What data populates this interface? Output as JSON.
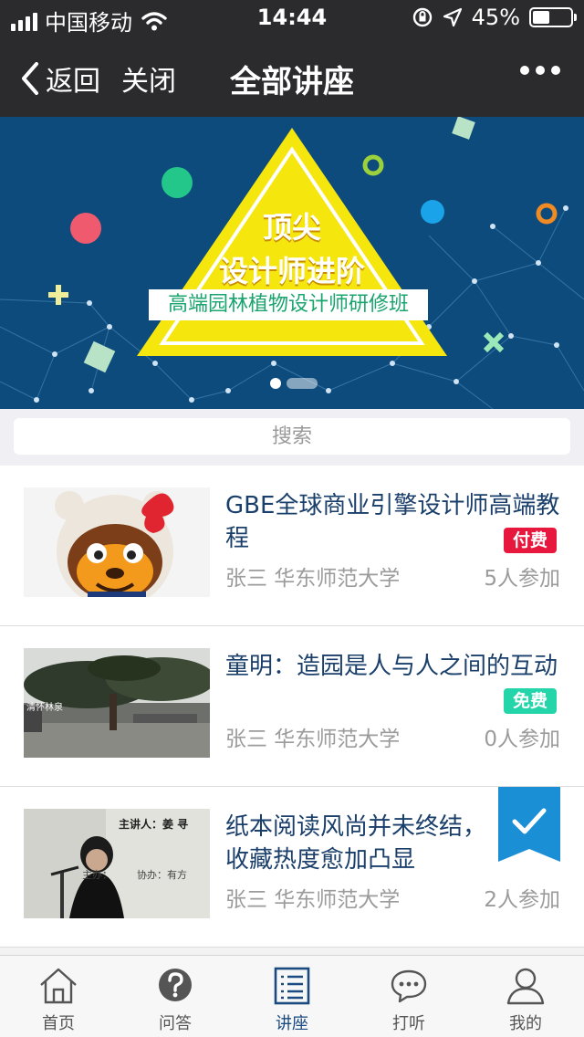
{
  "status_bar": {
    "carrier": "中国移动",
    "time": "14:44",
    "battery_percent_text": "45%",
    "battery_level": 0.45,
    "icons": [
      "signal-icon",
      "wifi-icon",
      "rotation-lock-icon",
      "location-icon",
      "battery-icon"
    ]
  },
  "nav": {
    "back_label": "返回",
    "close_label": "关闭",
    "title": "全部讲座",
    "more_icon": "more-dots-icon"
  },
  "banner": {
    "headline_line1": "顶尖",
    "headline_line2": "设计师进阶",
    "subtitle": "高端园林植物设计师研修班",
    "colors": {
      "background": "#0d4b7c",
      "triangle": "#f5e60e"
    },
    "slides_total": 2,
    "active_slide": 1
  },
  "search": {
    "placeholder": "搜索"
  },
  "lectures": [
    {
      "title": "GBE全球商业引擎设计师高端教程",
      "price_label": "付费",
      "price_type": "paid",
      "speaker": "张三 华东师范大学",
      "participants": "5人参加",
      "thumb": "monkey-mascot-photo",
      "bookmarked": false
    },
    {
      "title": "童明：造园是人与人之间的互动",
      "price_label": "免费",
      "price_type": "free",
      "speaker": "张三 华东师范大学",
      "participants": "0人参加",
      "thumb": "garden-tree-photo",
      "thumb_caption": "清怀林泉",
      "bookmarked": false
    },
    {
      "title": "纸本阅读风尚并未终结，收藏热度愈加凸显",
      "price_label": "",
      "price_type": "none",
      "speaker": "张三 华东师范大学",
      "participants": "2人参加",
      "thumb": "speaker-podium-photo",
      "thumb_text_1": "主讲人：姜 寻",
      "thumb_text_2": "主办：",
      "thumb_text_3": "协办：有方",
      "bookmarked": true,
      "bookmark_color": "#1b8fd6"
    }
  ],
  "tabs": [
    {
      "label": "首页",
      "icon": "home-icon",
      "active": false
    },
    {
      "label": "问答",
      "icon": "question-icon",
      "active": false
    },
    {
      "label": "讲座",
      "icon": "lecture-list-icon",
      "active": true
    },
    {
      "label": "打听",
      "icon": "chat-bubble-icon",
      "active": false
    },
    {
      "label": "我的",
      "icon": "user-icon",
      "active": false
    }
  ]
}
